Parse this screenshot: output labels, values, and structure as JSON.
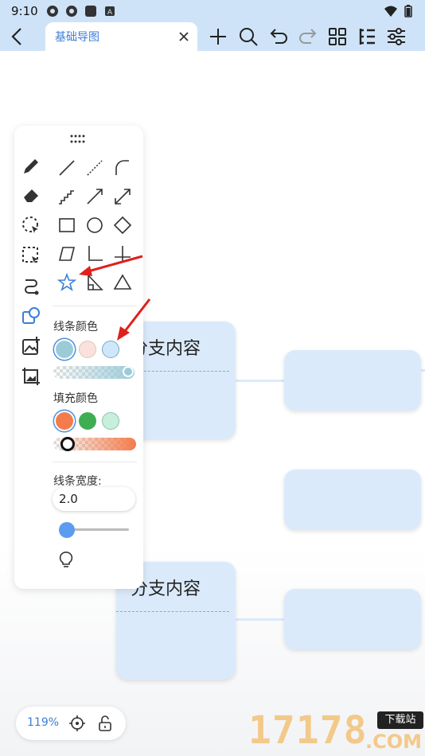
{
  "status_bar": {
    "time": "9:10"
  },
  "toolbar": {
    "tab_title": "基础导图"
  },
  "panel": {
    "line_color_label": "线条颜色",
    "fill_color_label": "填充颜色",
    "line_width_label": "线条宽度:",
    "line_width_value": "2.0",
    "line_colors": [
      "#9ccbd8",
      "#fbe1dc",
      "#cfe7fb"
    ],
    "fill_colors": [
      "#f47c4c",
      "#3fae53",
      "#c7f0dc"
    ],
    "selected_line_color": 0,
    "selected_fill_color": 0
  },
  "canvas": {
    "nodes": [
      "分支内容",
      "分支内容"
    ]
  },
  "zoom": {
    "level": "119%"
  },
  "watermark": {
    "digits": "17178",
    "badge": "下载站",
    "suffix": ".COM"
  },
  "colors": {
    "accent": "#3a7fd6",
    "toolbar_bg": "#cfe3f8",
    "node_bg": "#dbeafb",
    "arrow": "#e0201c"
  }
}
